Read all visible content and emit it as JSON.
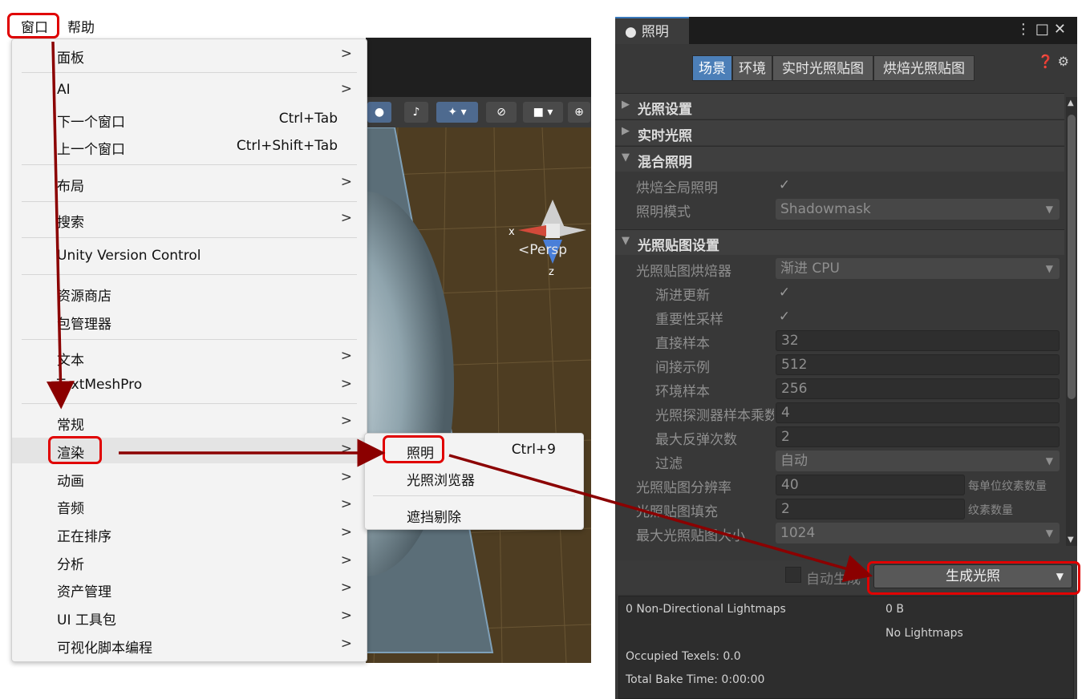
{
  "menubar": {
    "window": "窗口",
    "help": "帮助"
  },
  "menu": {
    "items": [
      {
        "label": "面板",
        "arrow": ">"
      },
      {
        "label": "AI",
        "arrow": ">"
      },
      {
        "label": "下一个窗口",
        "shortcut": "Ctrl+Tab"
      },
      {
        "label": "上一个窗口",
        "shortcut": "Ctrl+Shift+Tab"
      },
      {
        "label": "布局",
        "arrow": ">"
      },
      {
        "label": "搜索",
        "arrow": ">"
      },
      {
        "label": "Unity Version Control"
      },
      {
        "label": "资源商店"
      },
      {
        "label": "包管理器"
      },
      {
        "label": "文本",
        "arrow": ">"
      },
      {
        "label": "TextMeshPro",
        "arrow": ">"
      },
      {
        "label": "常规",
        "arrow": ">"
      },
      {
        "label": "渲染",
        "arrow": ">"
      },
      {
        "label": "动画",
        "arrow": ">"
      },
      {
        "label": "音频",
        "arrow": ">"
      },
      {
        "label": "正在排序",
        "arrow": ">"
      },
      {
        "label": "分析",
        "arrow": ">"
      },
      {
        "label": "资产管理",
        "arrow": ">"
      },
      {
        "label": "UI 工具包",
        "arrow": ">"
      },
      {
        "label": "可视化脚本编程",
        "arrow": ">"
      }
    ]
  },
  "submenu": {
    "items": [
      {
        "label": "照明",
        "shortcut": "Ctrl+9"
      },
      {
        "label": "光照浏览器"
      },
      {
        "label": "遮挡剔除"
      }
    ]
  },
  "scene": {
    "gizmo_x": "x",
    "gizmo_z": "z",
    "persp": "<Persp"
  },
  "lighting": {
    "tab_title": "照明",
    "tabs": [
      "场景",
      "环境",
      "实时光照贴图",
      "烘焙光照贴图"
    ],
    "sections": {
      "lighting_settings": "光照设置",
      "realtime": "实时光照",
      "mixed": "混合照明",
      "lightmap_settings": "光照贴图设置"
    },
    "mixed": {
      "baked_gi_label": "烘焙全局照明",
      "mode_label": "照明模式",
      "mode_value": "Shadowmask"
    },
    "lightmap": {
      "baker_label": "光照贴图烘焙器",
      "baker_value": "渐进 CPU",
      "progressive_updates_label": "渐进更新",
      "importance_sampling_label": "重要性采样",
      "direct_samples_label": "直接样本",
      "direct_samples_value": "32",
      "indirect_samples_label": "间接示例",
      "indirect_samples_value": "512",
      "env_samples_label": "环境样本",
      "env_samples_value": "256",
      "probe_multiplier_label": "光照探测器样本乘数",
      "probe_multiplier_value": "4",
      "max_bounces_label": "最大反弹次数",
      "max_bounces_value": "2",
      "filter_label": "过滤",
      "filter_value": "自动",
      "resolution_label": "光照贴图分辨率",
      "resolution_value": "40",
      "resolution_unit": "每单位纹素数量",
      "padding_label": "光照贴图填充",
      "padding_value": "2",
      "padding_unit": "纹素数量",
      "max_size_label": "最大光照贴图大小",
      "max_size_value": "1024"
    },
    "auto_generate": "自动生成",
    "generate_button": "生成光照",
    "info": {
      "lightmaps": "0 Non-Directional Lightmaps",
      "size": "0 B",
      "no_lightmaps": "No Lightmaps",
      "occupied": "Occupied Texels: 0.0",
      "bake_time": "Total Bake Time: 0:00:00"
    }
  },
  "colors": {
    "highlight": "#e00000",
    "arrow": "#8b0000",
    "accent": "#4c7fb8"
  }
}
